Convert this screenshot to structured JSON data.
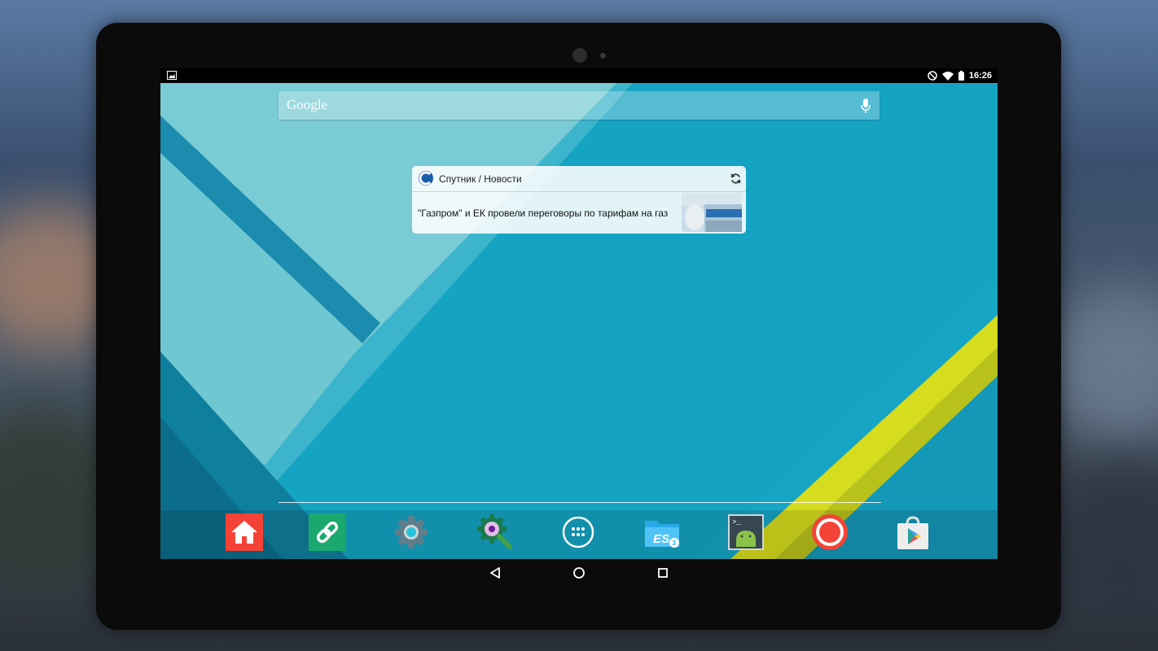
{
  "status_bar": {
    "time": "16:26",
    "icons": [
      "image-notification-icon",
      "do-not-disturb-icon",
      "wifi-icon",
      "battery-icon"
    ]
  },
  "search_bar": {
    "logo_text": "Google",
    "mic_icon": "mic-icon"
  },
  "news_widget": {
    "title": "Спутник / Новости",
    "headline": "\"Газпром\" и ЕК провели переговоры по тарифам на газ",
    "logo_icon": "sputnik-logo-icon",
    "refresh_icon": "refresh-icon"
  },
  "dock": {
    "apps": [
      {
        "icon": "home-icon"
      },
      {
        "icon": "link-icon"
      },
      {
        "icon": "settings-gear-icon"
      },
      {
        "icon": "search-gear-icon"
      },
      {
        "icon": "app-drawer-icon"
      },
      {
        "icon": "es-file-explorer-icon"
      },
      {
        "icon": "android-terminal-icon"
      },
      {
        "icon": "record-icon"
      },
      {
        "icon": "play-store-icon"
      }
    ]
  },
  "nav_bar": {
    "back_icon": "back-triangle-icon",
    "home_icon": "home-circle-icon",
    "recents_icon": "recents-square-icon"
  },
  "colors": {
    "wallpaper_teal": "#14a0bf",
    "stripe_yellow": "#d6dc1e",
    "dock_red": "#f44336",
    "dock_green": "#1aa86d"
  }
}
